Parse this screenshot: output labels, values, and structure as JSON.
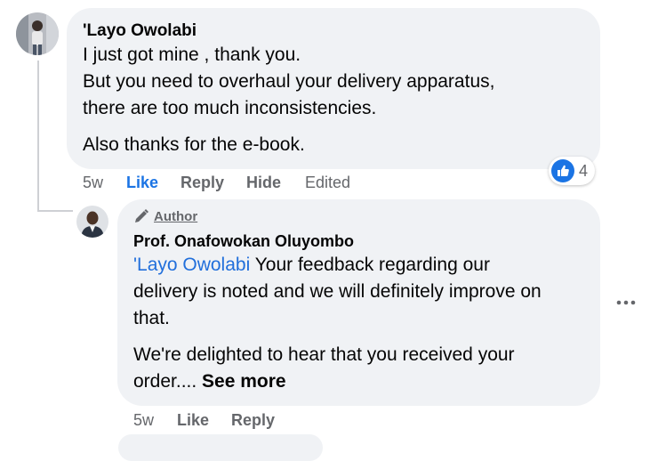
{
  "comment": {
    "author": "'Layo Owolabi",
    "lines": [
      "I just got mine , thank you.",
      "But you need to overhaul your delivery apparatus,",
      "there are too much inconsistencies.",
      "Also thanks for the e-book."
    ],
    "time": "5w",
    "like_label": "Like",
    "reply_label": "Reply",
    "hide_label": "Hide",
    "edited_label": "Edited",
    "reaction_count": "4",
    "reaction_icon": "thumbs-up-icon",
    "accent_color": "#1b74e4"
  },
  "reply": {
    "badge_label": "Author",
    "badge_icon": "pencil-icon",
    "author": "Prof. Onafowokan Oluyombo",
    "mention": "'Layo Owolabi",
    "line1_rest": " Your feedback regarding our",
    "line2": "delivery is noted and we will definitely improve on",
    "line3": "that.",
    "line4": "We're delighted to hear that you received your",
    "line5_text": "order....",
    "see_more": "See more",
    "time": "5w",
    "like_label": "Like",
    "reply_label": "Reply",
    "mention_color": "#216fdb"
  }
}
